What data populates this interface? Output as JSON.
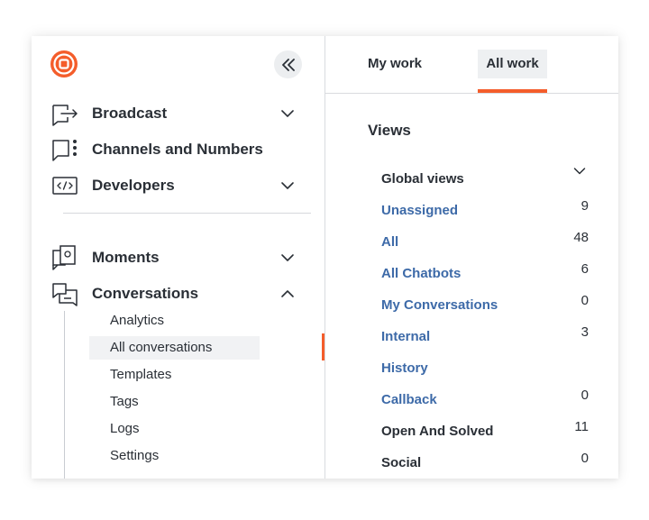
{
  "sidebar": {
    "collapse_icon": "double-chevron-left-icon",
    "nav": [
      {
        "label": "Broadcast",
        "icon": "broadcast-icon",
        "expandable": true,
        "expanded": false
      },
      {
        "label": "Channels and Numbers",
        "icon": "chat-channels-icon",
        "expandable": false
      },
      {
        "label": "Developers",
        "icon": "code-icon",
        "expandable": true,
        "expanded": false
      },
      {
        "label": "Moments",
        "icon": "moments-icon",
        "expandable": true,
        "expanded": false
      },
      {
        "label": "Conversations",
        "icon": "conversations-icon",
        "expandable": true,
        "expanded": true
      }
    ],
    "conversations_sub": [
      "Analytics",
      "All conversations",
      "Templates",
      "Tags",
      "Logs",
      "Settings"
    ],
    "active_sub": "All conversations"
  },
  "tabs": [
    "My work",
    "All work"
  ],
  "active_tab": "All work",
  "views": {
    "title": "Views",
    "group": "Global views",
    "items": [
      {
        "label": "Unassigned",
        "count": "9",
        "link": true
      },
      {
        "label": "All",
        "count": "48",
        "link": true
      },
      {
        "label": "All Chatbots",
        "count": "6",
        "link": true
      },
      {
        "label": "My Conversations",
        "count": "0",
        "link": true
      },
      {
        "label": "Internal",
        "count": "3",
        "link": true
      },
      {
        "label": "History",
        "count": "",
        "link": true
      },
      {
        "label": "Callback",
        "count": "0",
        "link": true
      },
      {
        "label": "Open And Solved",
        "count": "11",
        "link": false
      },
      {
        "label": "Social",
        "count": "0",
        "link": false
      }
    ]
  },
  "colors": {
    "accent": "#f45d2b",
    "link": "#3d6aa8",
    "text": "#2a2f36"
  }
}
